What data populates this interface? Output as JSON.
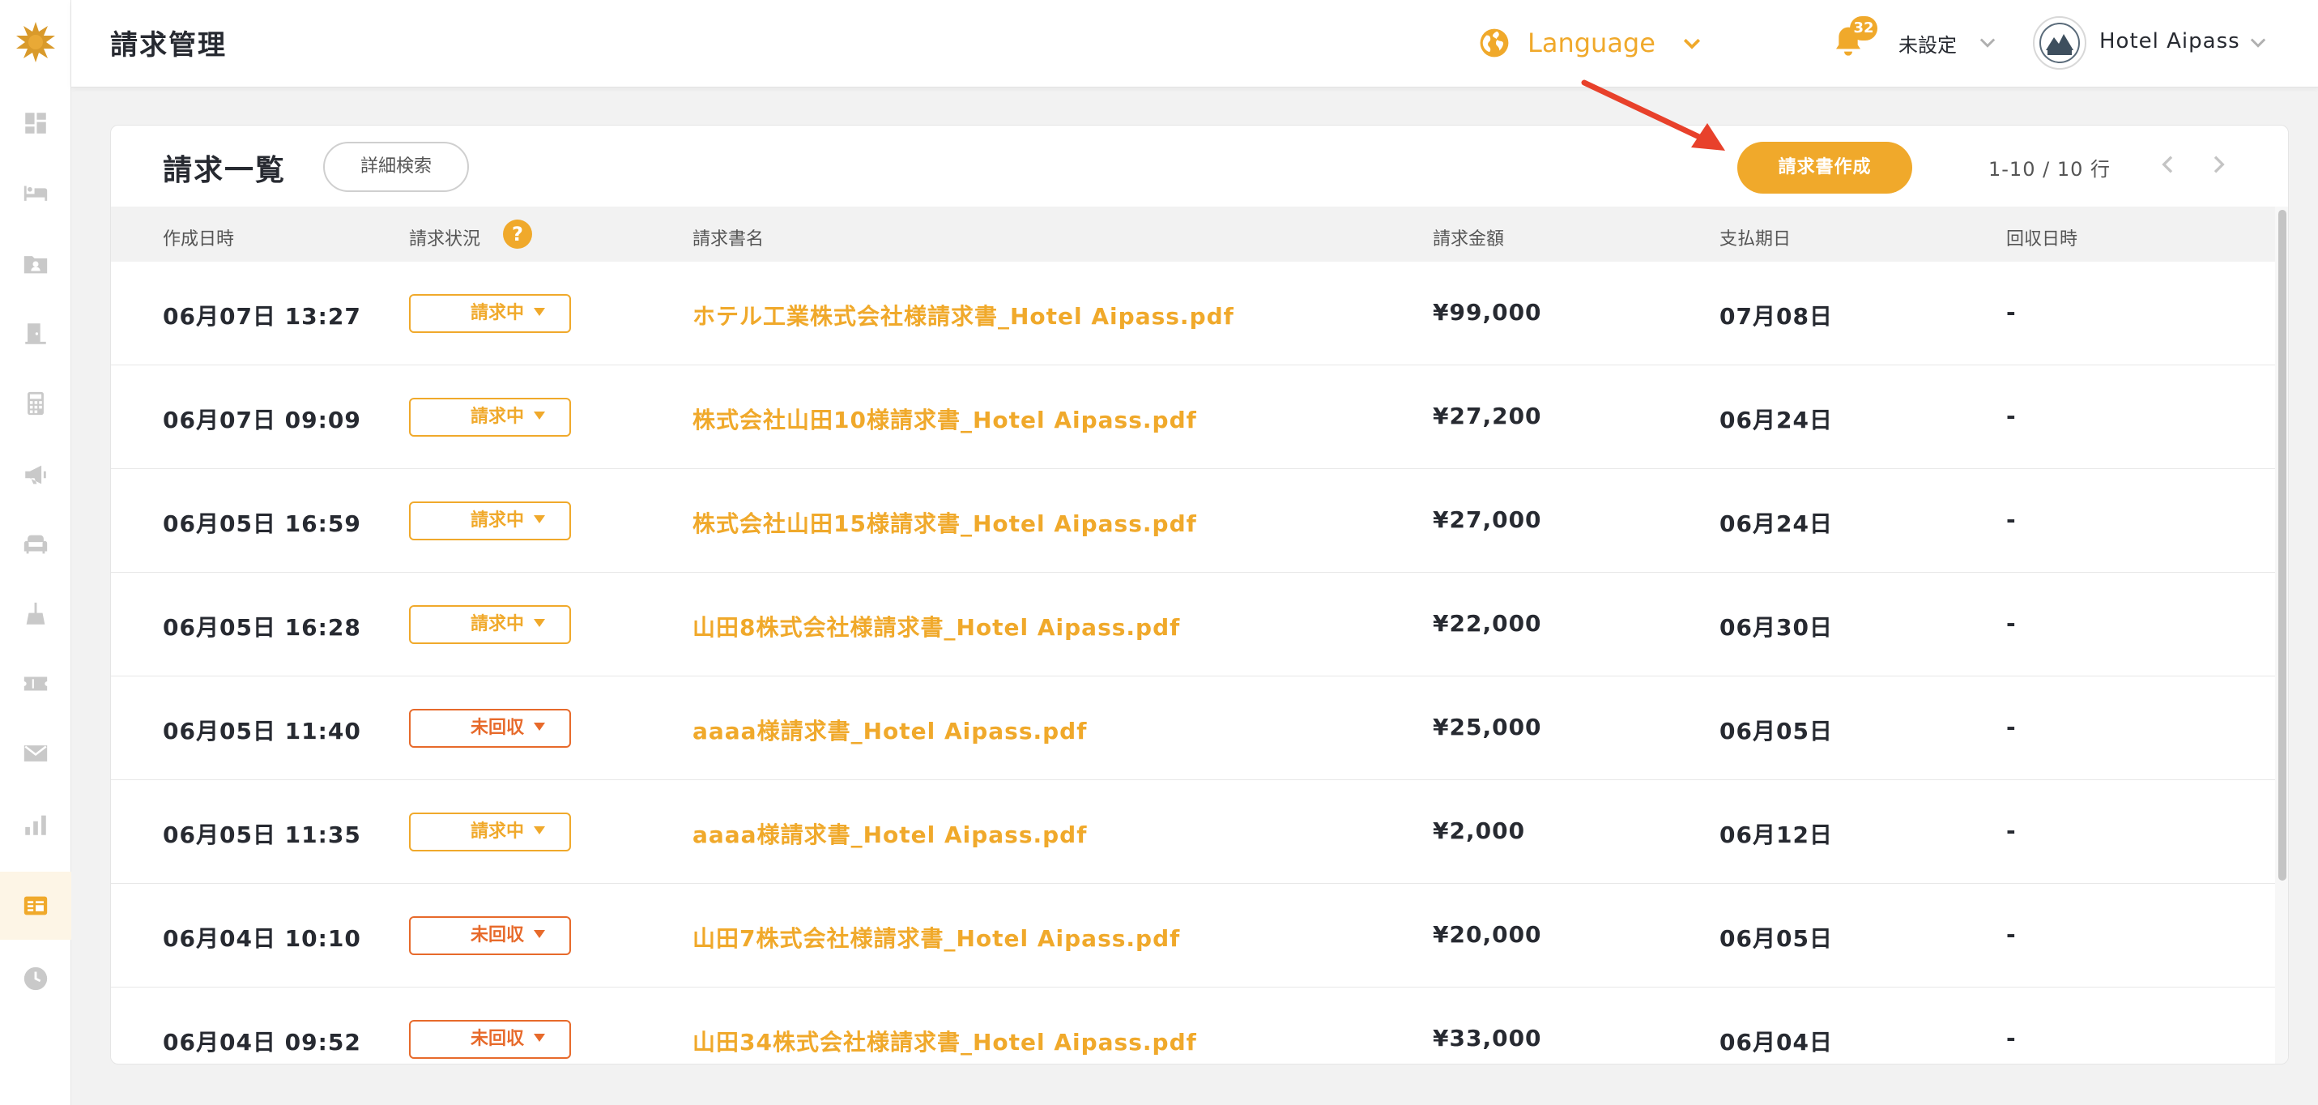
{
  "header": {
    "title": "請求管理",
    "language_label": "Language",
    "notification_count": "32",
    "status_label": "未設定",
    "hotel_name": "Hotel Aipass"
  },
  "sidebar": {
    "items": [
      {
        "icon": "dashboard-icon"
      },
      {
        "icon": "bed-icon"
      },
      {
        "icon": "folder-user-icon"
      },
      {
        "icon": "door-icon"
      },
      {
        "icon": "calculator-icon"
      },
      {
        "icon": "megaphone-icon"
      },
      {
        "icon": "sofa-icon"
      },
      {
        "icon": "broom-icon"
      },
      {
        "icon": "ticket-icon"
      },
      {
        "icon": "mail-icon"
      },
      {
        "icon": "bar-chart-icon"
      },
      {
        "icon": "invoice-icon",
        "active": true
      },
      {
        "icon": "clock-icon"
      }
    ]
  },
  "main": {
    "title": "請求一覧",
    "detail_search": "詳細検索",
    "create_button": "請求書作成",
    "pagination": "1-10 / 10 行",
    "columns": [
      "作成日時",
      "請求状況",
      "請求書名",
      "請求金額",
      "支払期日",
      "回収日時"
    ],
    "help_symbol": "?",
    "rows": [
      {
        "date": "06月07日 13:27",
        "status": "請求中",
        "status_type": "billing",
        "file": "ホテル工業株式会社様請求書_Hotel Aipass.pdf",
        "amount": "¥99,000",
        "due": "07月08日",
        "collected": "-"
      },
      {
        "date": "06月07日 09:09",
        "status": "請求中",
        "status_type": "billing",
        "file": "株式会社山田10様請求書_Hotel Aipass.pdf",
        "amount": "¥27,200",
        "due": "06月24日",
        "collected": "-"
      },
      {
        "date": "06月05日 16:59",
        "status": "請求中",
        "status_type": "billing",
        "file": "株式会社山田15様請求書_Hotel Aipass.pdf",
        "amount": "¥27,000",
        "due": "06月24日",
        "collected": "-"
      },
      {
        "date": "06月05日 16:28",
        "status": "請求中",
        "status_type": "billing",
        "file": "山田8株式会社様請求書_Hotel Aipass.pdf",
        "amount": "¥22,000",
        "due": "06月30日",
        "collected": "-"
      },
      {
        "date": "06月05日 11:40",
        "status": "未回収",
        "status_type": "uncollected",
        "file": "aaaa様請求書_Hotel Aipass.pdf",
        "amount": "¥25,000",
        "due": "06月05日",
        "collected": "-"
      },
      {
        "date": "06月05日 11:35",
        "status": "請求中",
        "status_type": "billing",
        "file": "aaaa様請求書_Hotel Aipass.pdf",
        "amount": "¥2,000",
        "due": "06月12日",
        "collected": "-"
      },
      {
        "date": "06月04日 10:10",
        "status": "未回収",
        "status_type": "uncollected",
        "file": "山田7株式会社様請求書_Hotel Aipass.pdf",
        "amount": "¥20,000",
        "due": "06月05日",
        "collected": "-"
      },
      {
        "date": "06月04日 09:52",
        "status": "未回収",
        "status_type": "uncollected",
        "file": "山田34株式会社様請求書_Hotel Aipass.pdf",
        "amount": "¥33,000",
        "due": "06月04日",
        "collected": "-"
      }
    ]
  },
  "colors": {
    "accent": "#f0a92b",
    "uncollected": "#e76a2b",
    "arrow": "#e8412b"
  }
}
